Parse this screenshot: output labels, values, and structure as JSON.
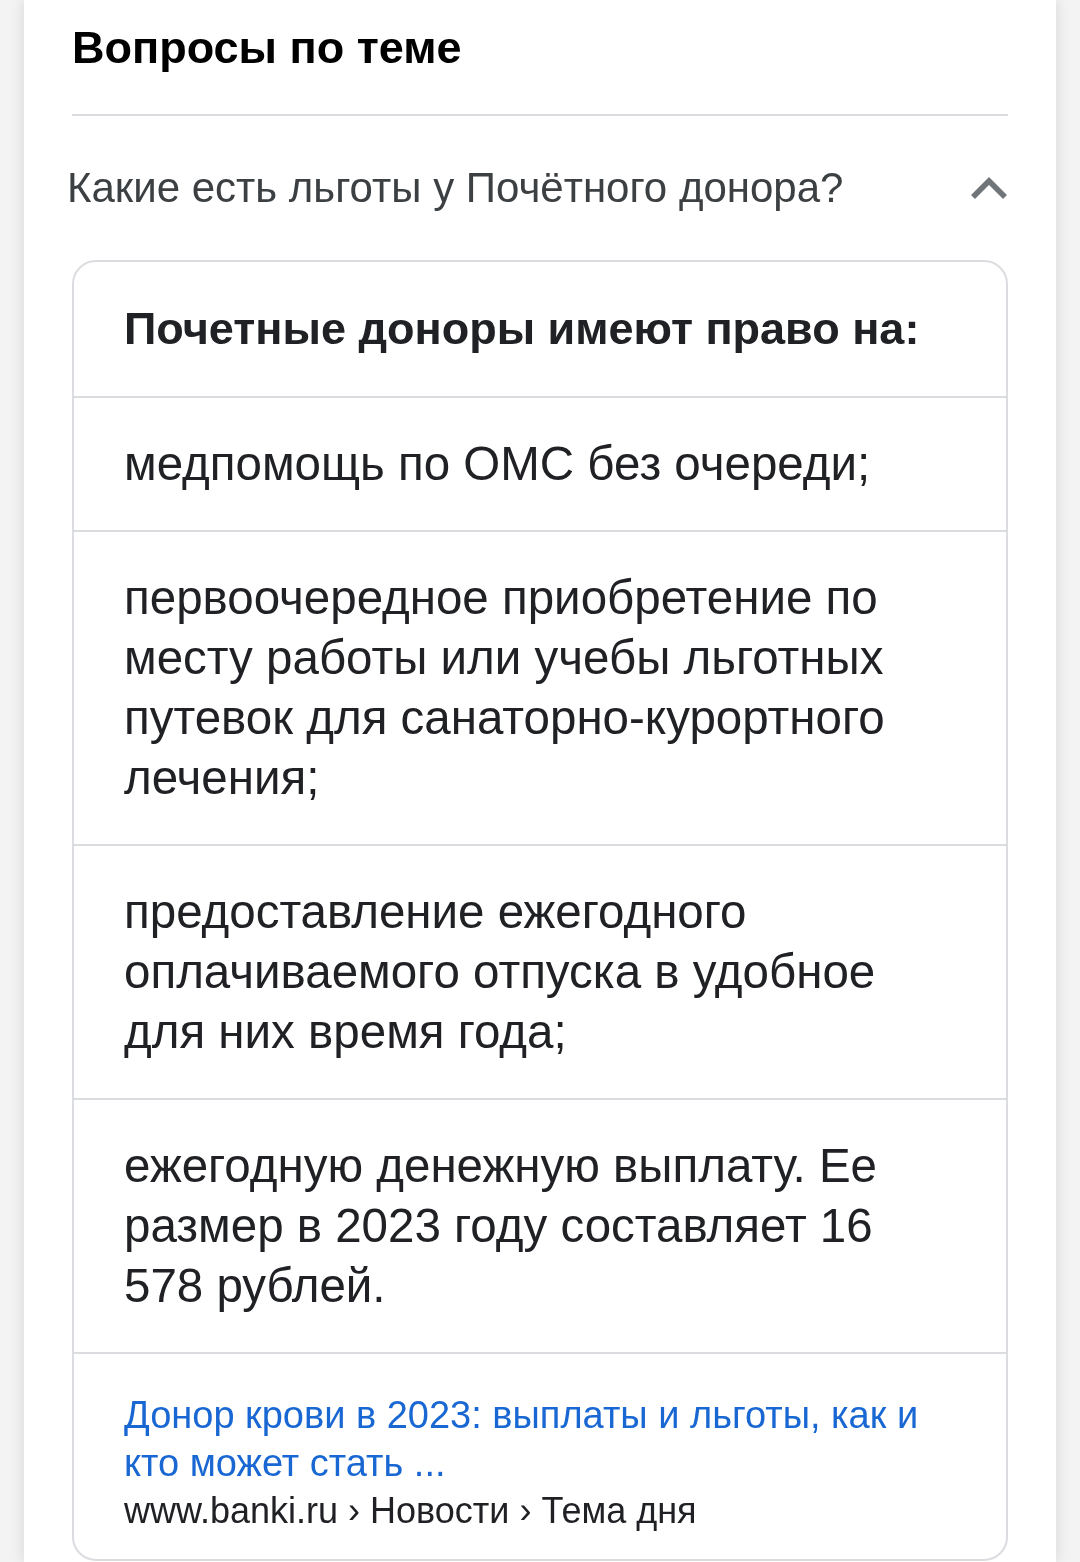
{
  "section": {
    "title": "Вопросы по теме"
  },
  "questions": [
    {
      "text": "Какие есть льготы у Почётного донора?",
      "expanded": true,
      "answer": {
        "heading": "Почетные доноры имеют право на:",
        "items": [
          "медпомощь по ОМС без очереди;",
          "первоочередное приобретение по месту работы или учебы льготных путевок для санаторно-курортного лечения;",
          "предоставление ежегодного оплачиваемого отпуска в удобное для них время года;",
          "ежегодную денежную выплату. Ее размер в 2023 году составляет 16 578 рублей."
        ],
        "source": {
          "title": "Донор крови в 2023: выплаты и льготы, как и кто может стать ...",
          "breadcrumb": "www.banki.ru › Новости › Тема дня"
        }
      }
    }
  ]
}
